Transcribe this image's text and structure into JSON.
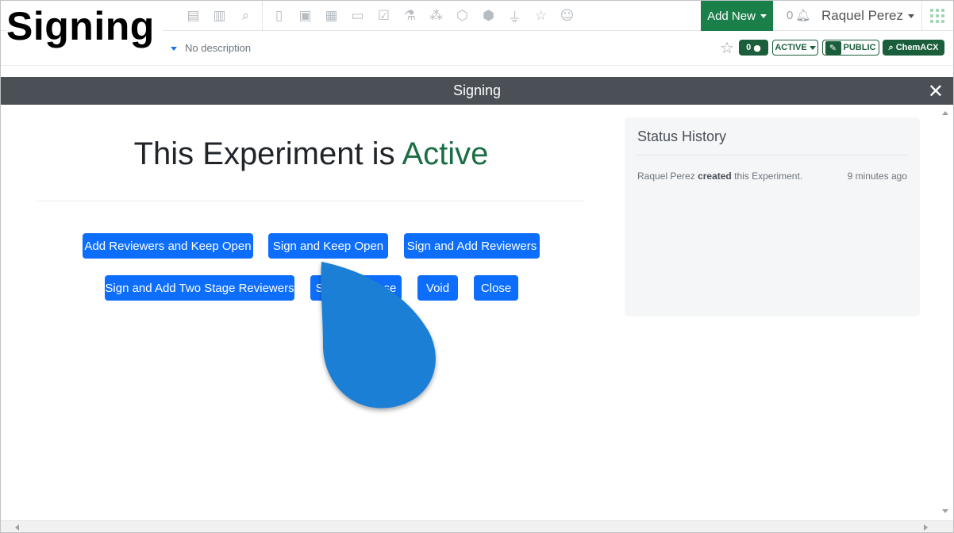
{
  "overlay_title": "Signing",
  "topnav": {
    "icons": [
      "report-icon",
      "bar-chart-icon",
      "search-icon",
      "notebook-icon",
      "clipboard-icon",
      "calendar-icon",
      "presentation-icon",
      "clipboard-check-icon",
      "lab-icon",
      "molecule-icon",
      "hexagon-icon",
      "shield-icon",
      "flask-icon",
      "star-icon",
      "user-icon"
    ],
    "add_new_label": "Add New",
    "notification_count": "0",
    "user_name": "Raquel Perez"
  },
  "subheader": {
    "description": "No description",
    "comment_count": "0",
    "status_label": "ACTIVE",
    "visibility_label": "PUBLIC",
    "chem_label": "ChemACX"
  },
  "modal": {
    "title": "Signing",
    "status_prefix": "This Experiment is",
    "status_value": "Active",
    "buttons": {
      "add_reviewers_keep_open": "Add Reviewers and Keep Open",
      "sign_keep_open": "Sign and Keep Open",
      "sign_add_reviewers": "Sign and Add Reviewers",
      "sign_two_stage": "Sign and Add Two Stage Reviewers",
      "sign_close": "Sign and Close",
      "void": "Void",
      "close": "Close"
    },
    "history": {
      "title": "Status History",
      "entry_user": "Raquel Perez",
      "entry_action": "created",
      "entry_rest": "this Experiment.",
      "entry_time": "9 minutes ago"
    }
  },
  "colors": {
    "primary": "#0d6efd",
    "brand_green": "#1b7f4a",
    "active_green": "#1b6e44",
    "modal_header": "#4b5057",
    "pointer_blue": "#1a7fd6"
  }
}
